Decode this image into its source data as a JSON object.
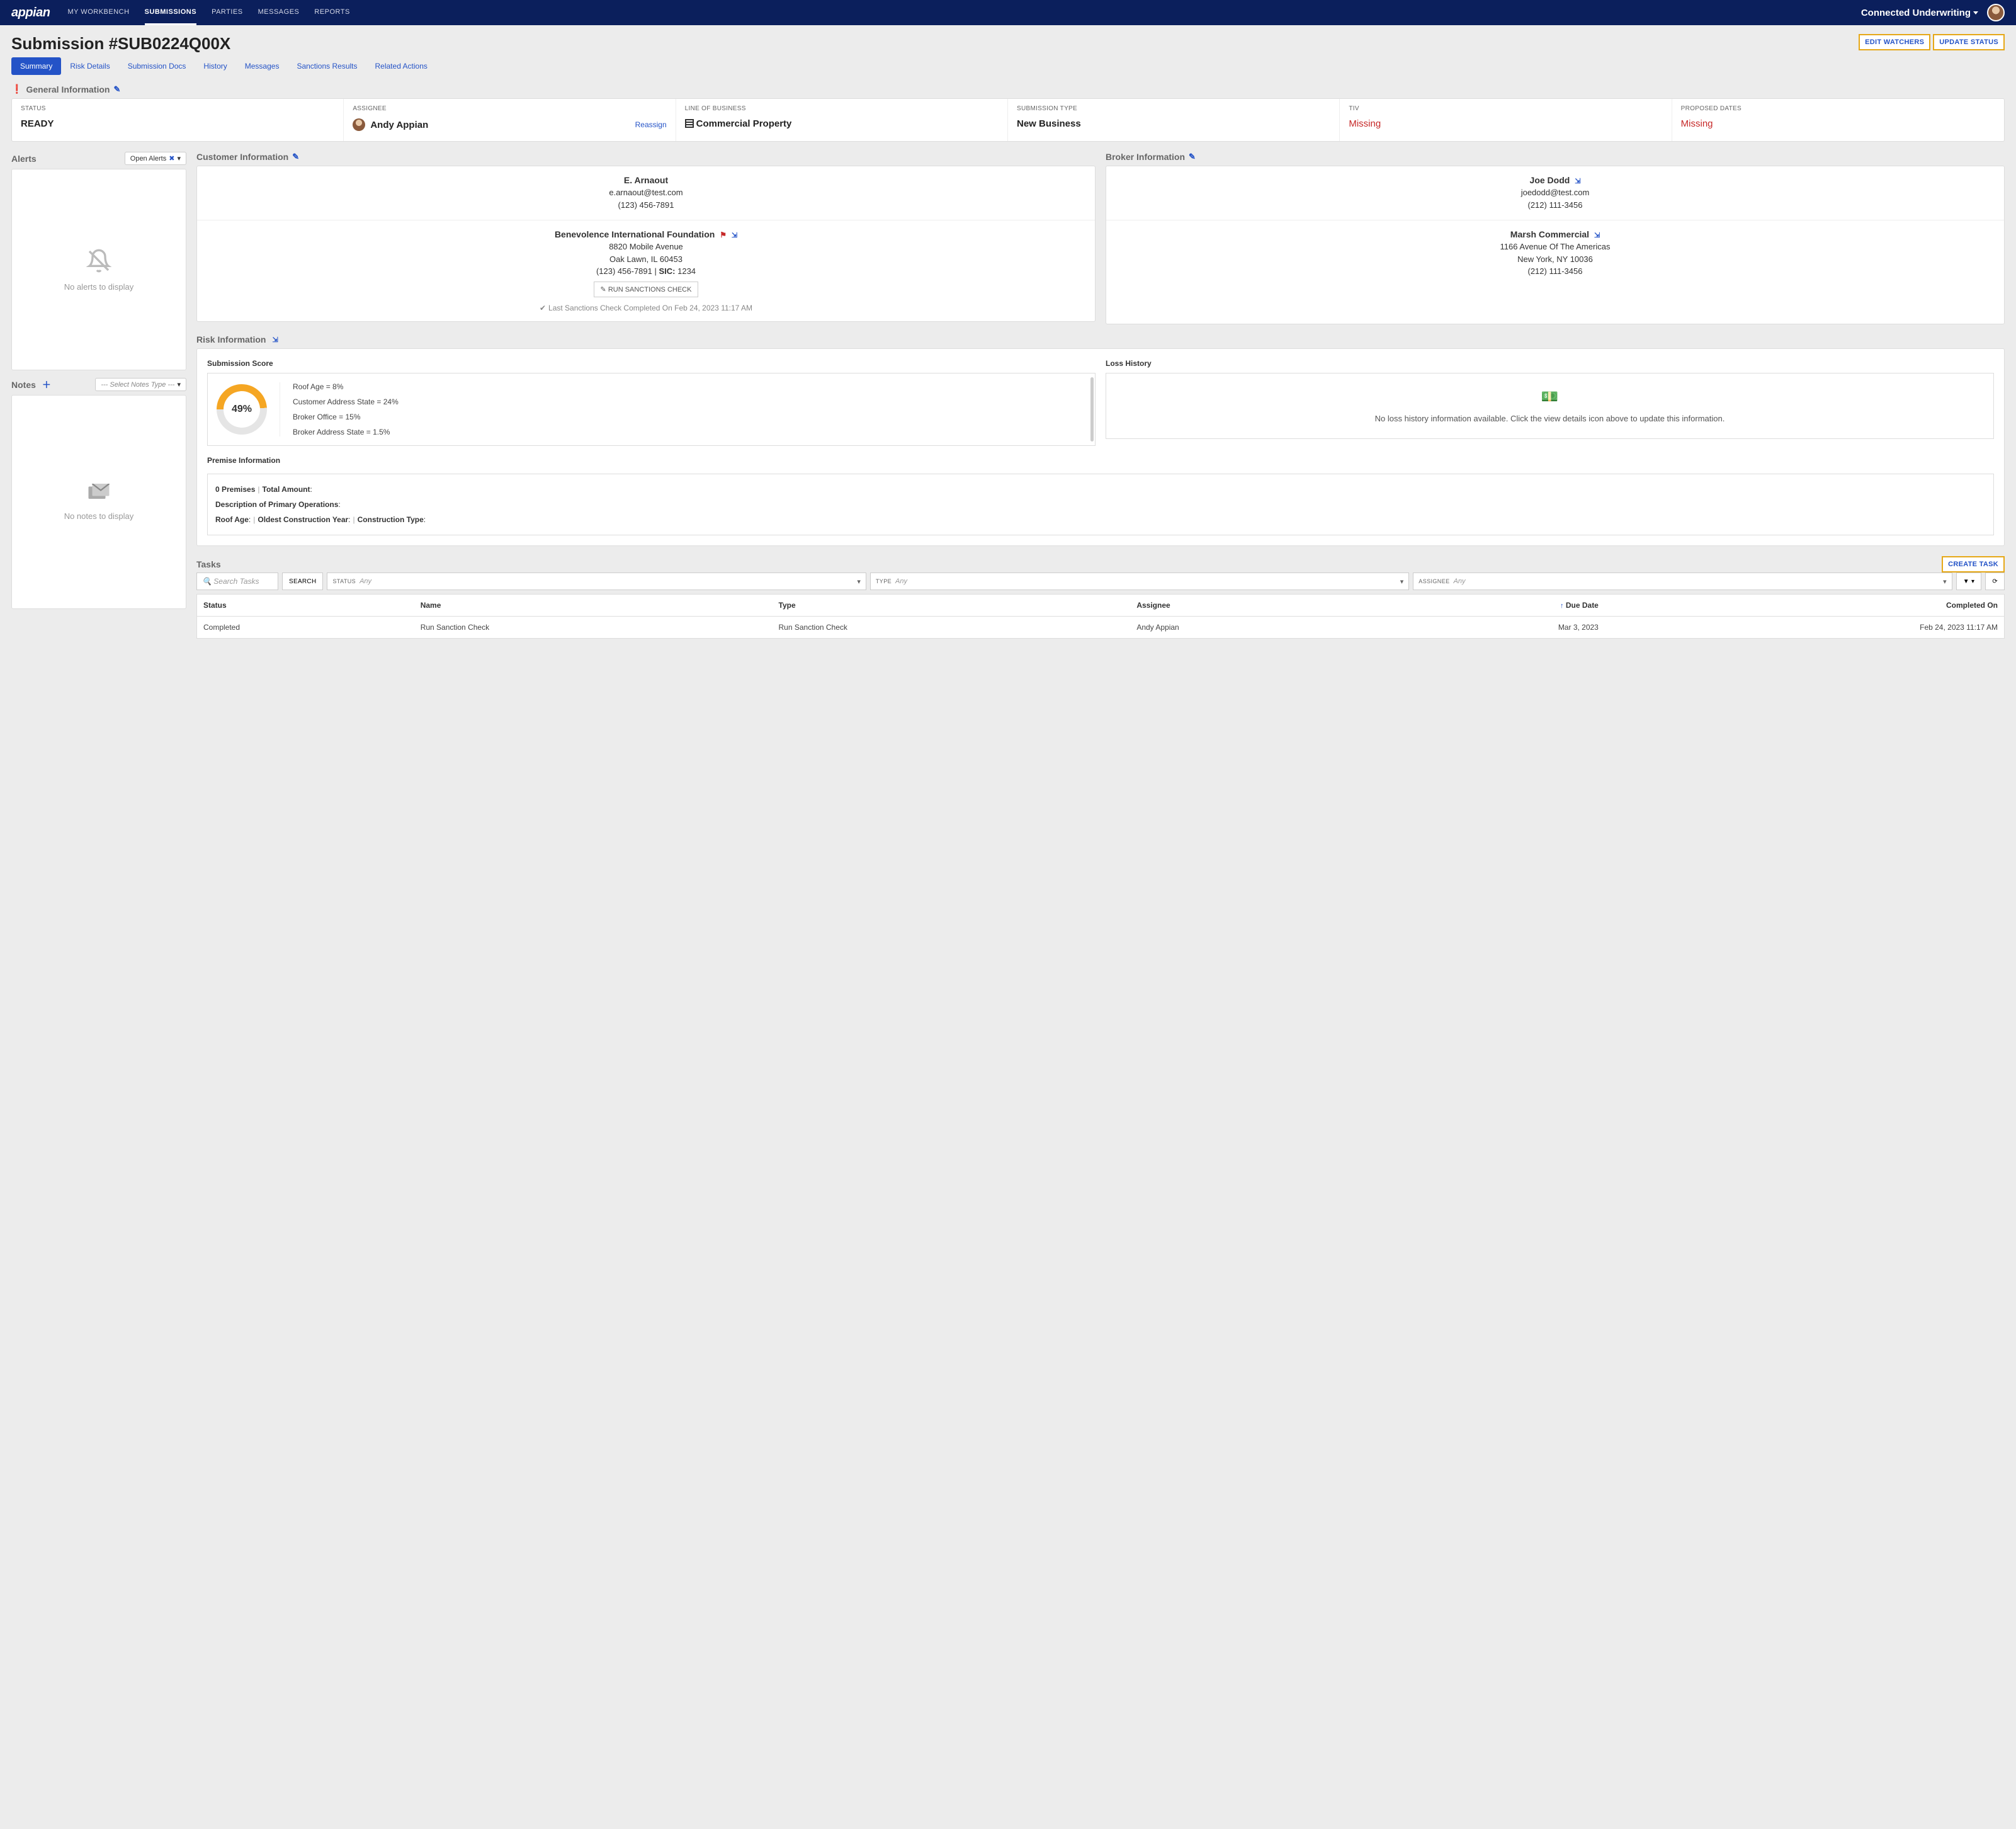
{
  "nav": {
    "logo": "appian",
    "items": [
      "MY WORKBENCH",
      "SUBMISSIONS",
      "PARTIES",
      "MESSAGES",
      "REPORTS"
    ],
    "active_index": 1,
    "app_title": "Connected Underwriting"
  },
  "page": {
    "title": "Submission #SUB0224Q00X",
    "buttons": {
      "edit_watchers": "EDIT WATCHERS",
      "update_status": "UPDATE STATUS"
    },
    "tabs": [
      "Summary",
      "Risk Details",
      "Submission Docs",
      "History",
      "Messages",
      "Sanctions Results",
      "Related Actions"
    ],
    "active_tab": 0
  },
  "general_info": {
    "title": "General Information",
    "cells": {
      "status": {
        "label": "STATUS",
        "value": "READY"
      },
      "assignee": {
        "label": "ASSIGNEE",
        "value": "Andy Appian",
        "reassign": "Reassign"
      },
      "lob": {
        "label": "LINE OF BUSINESS",
        "value": "Commercial Property"
      },
      "sub_type": {
        "label": "SUBMISSION TYPE",
        "value": "New Business"
      },
      "tiv": {
        "label": "TIV",
        "value": "Missing"
      },
      "dates": {
        "label": "PROPOSED DATES",
        "value": "Missing"
      }
    }
  },
  "alerts": {
    "title": "Alerts",
    "filter": "Open Alerts",
    "empty": "No alerts to display"
  },
  "notes": {
    "title": "Notes",
    "select_placeholder": "--- Select Notes Type ---",
    "empty": "No notes to display"
  },
  "customer": {
    "title": "Customer Information",
    "contact": {
      "name": "E. Arnaout",
      "email": "e.arnaout@test.com",
      "phone": "(123) 456-7891"
    },
    "company": {
      "name": "Benevolence International Foundation",
      "addr1": "8820 Mobile Avenue",
      "addr2": "Oak Lawn, IL 60453",
      "phone": "(123) 456-7891",
      "sic_label": "SIC:",
      "sic": "1234",
      "btn": "RUN SANCTIONS CHECK",
      "last": "Last Sanctions Check Completed On Feb 24, 2023 11:17 AM"
    }
  },
  "broker": {
    "title": "Broker Information",
    "contact": {
      "name": "Joe Dodd",
      "email": "joedodd@test.com",
      "phone": "(212) 111-3456"
    },
    "company": {
      "name": "Marsh Commercial",
      "addr1": "1166 Avenue Of The Americas",
      "addr2": "New York, NY 10036",
      "phone": "(212) 111-3456"
    }
  },
  "risk": {
    "title": "Risk Information",
    "score_title": "Submission Score",
    "score_pct": "49%",
    "factors": [
      "Roof Age = 8%",
      "Customer Address State = 24%",
      "Broker Office = 15%",
      "Broker Address State = 1.5%"
    ],
    "loss_title": "Loss History",
    "loss_empty": "No loss history information available. Click the view details icon above to update this information.",
    "premise_title": "Premise Information",
    "premise": {
      "line1_a": "0 Premises",
      "line1_b": "Total Amount",
      "line2": "Description of Primary Operations",
      "line3_a": "Roof Age",
      "line3_b": "Oldest Construction Year",
      "line3_c": "Construction Type"
    }
  },
  "tasks": {
    "title": "Tasks",
    "create": "CREATE TASK",
    "search_placeholder": "Search Tasks",
    "search_btn": "SEARCH",
    "filters": {
      "status": {
        "label": "STATUS",
        "value": "Any"
      },
      "type": {
        "label": "TYPE",
        "value": "Any"
      },
      "assignee": {
        "label": "ASSIGNEE",
        "value": "Any"
      }
    },
    "columns": [
      "Status",
      "Name",
      "Type",
      "Assignee",
      "Due Date",
      "Completed On"
    ],
    "rows": [
      {
        "status": "Completed",
        "name": "Run Sanction Check",
        "type": "Run Sanction Check",
        "assignee": "Andy Appian",
        "due": "Mar 3, 2023",
        "completed": "Feb 24, 2023 11:17 AM"
      }
    ]
  },
  "chart_data": {
    "type": "pie",
    "title": "Submission Score",
    "categories": [
      "Score",
      "Remaining"
    ],
    "values": [
      49,
      51
    ],
    "series": [
      {
        "name": "Roof Age",
        "values": [
          8
        ]
      },
      {
        "name": "Customer Address State",
        "values": [
          24
        ]
      },
      {
        "name": "Broker Office",
        "values": [
          15
        ]
      },
      {
        "name": "Broker Address State",
        "values": [
          1.5
        ]
      }
    ]
  }
}
